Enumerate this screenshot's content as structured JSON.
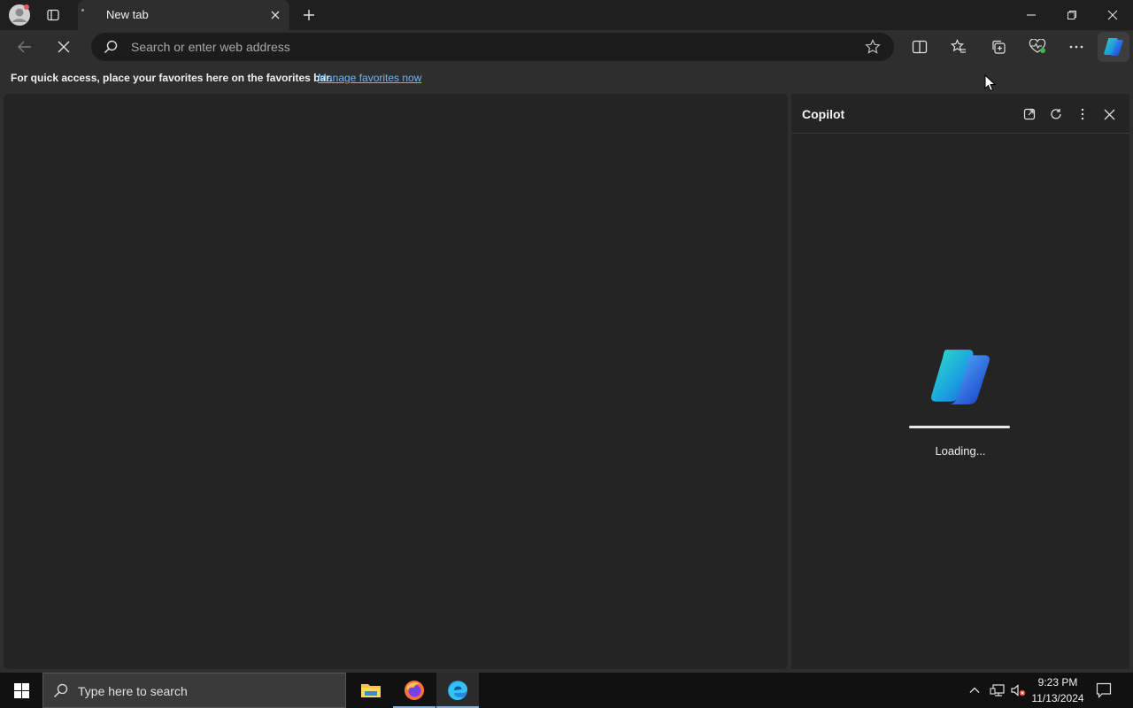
{
  "browser": {
    "tab": {
      "title": "New tab"
    },
    "address_bar": {
      "placeholder": "Search or enter web address"
    },
    "favorites_bar": {
      "message": "For quick access, place your favorites here on the favorites bar.",
      "link": "Manage favorites now"
    }
  },
  "copilot_pane": {
    "title": "Copilot",
    "loading_text": "Loading...",
    "loading_progress": 1.0
  },
  "taskbar": {
    "search_placeholder": "Type here to search",
    "apps": [
      "file-explorer",
      "firefox",
      "edge"
    ],
    "clock": {
      "time": "9:23 PM",
      "date": "11/13/2024"
    }
  },
  "colors": {
    "accent": "#6cb7ff",
    "taskbar_active": "#7eb2e6"
  }
}
